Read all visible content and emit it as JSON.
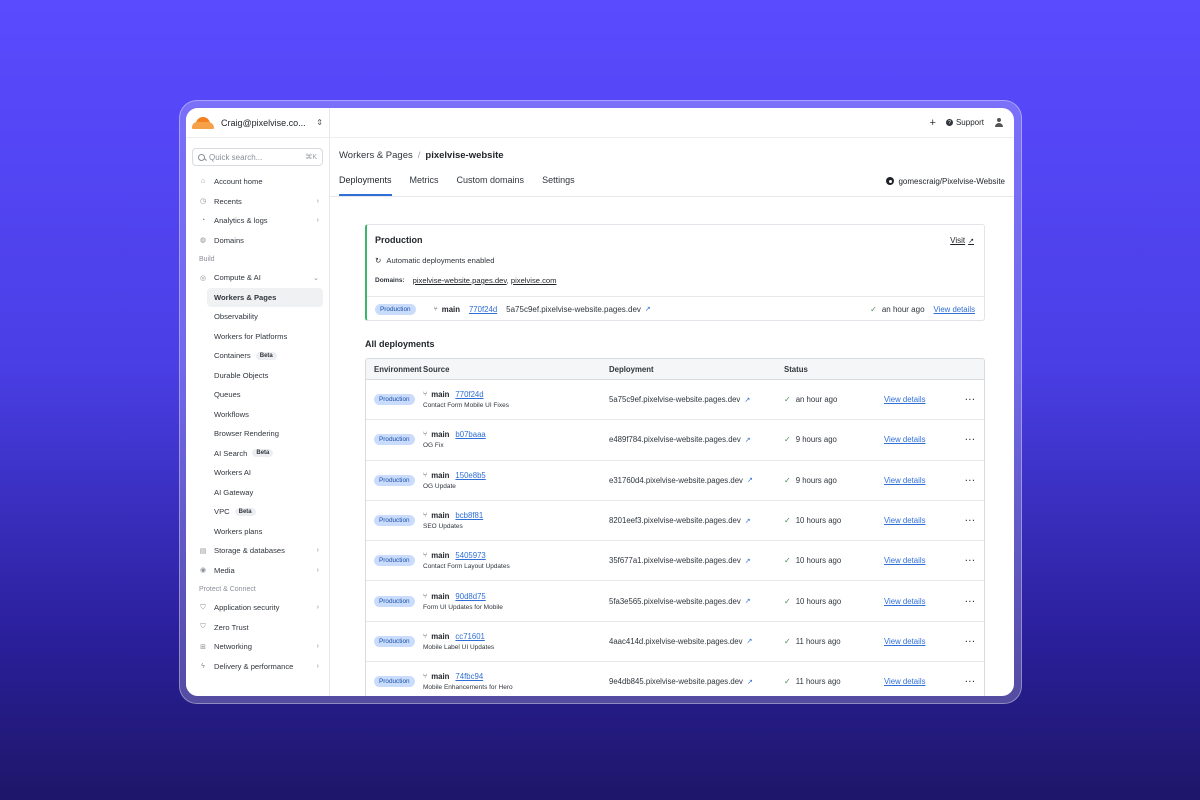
{
  "account": {
    "name": "Craig@pixelvise.co..."
  },
  "search": {
    "placeholder": "Quick search...",
    "shortcut": "⌘K"
  },
  "sidebar": {
    "top": [
      {
        "label": "Account home",
        "icon": "home-icon",
        "chev": false
      },
      {
        "label": "Recents",
        "icon": "clock-icon",
        "chev": true
      },
      {
        "label": "Analytics & logs",
        "icon": "chart-icon",
        "chev": true
      },
      {
        "label": "Domains",
        "icon": "globe-icon",
        "chev": false
      }
    ],
    "build_label": "Build",
    "compute": {
      "label": "Compute & AI",
      "icon": "cpu-icon"
    },
    "compute_items": [
      {
        "label": "Workers & Pages",
        "active": true,
        "beta": false
      },
      {
        "label": "Observability",
        "beta": false
      },
      {
        "label": "Workers for Platforms",
        "beta": false
      },
      {
        "label": "Containers",
        "beta": true
      },
      {
        "label": "Durable Objects",
        "beta": false
      },
      {
        "label": "Queues",
        "beta": false
      },
      {
        "label": "Workflows",
        "beta": false
      },
      {
        "label": "Browser Rendering",
        "beta": false
      },
      {
        "label": "AI Search",
        "beta": true
      },
      {
        "label": "Workers AI",
        "beta": false
      },
      {
        "label": "AI Gateway",
        "beta": false
      },
      {
        "label": "VPC",
        "beta": true
      },
      {
        "label": "Workers plans",
        "beta": false
      }
    ],
    "beta_label": "Beta",
    "after": [
      {
        "label": "Storage & databases",
        "icon": "database-icon",
        "chev": true
      },
      {
        "label": "Media",
        "icon": "media-icon",
        "chev": true
      }
    ],
    "protect_label": "Protect & Connect",
    "protect": [
      {
        "label": "Application security",
        "icon": "shield-icon",
        "chev": true
      },
      {
        "label": "Zero Trust",
        "icon": "shield-check-icon",
        "chev": false
      },
      {
        "label": "Networking",
        "icon": "network-icon",
        "chev": true
      },
      {
        "label": "Delivery & performance",
        "icon": "bolt-icon",
        "chev": true
      }
    ]
  },
  "topbar": {
    "plus": "+",
    "support": "Support"
  },
  "breadcrumb": {
    "parent": "Workers & Pages",
    "sep": "/",
    "current": "pixelvise-website"
  },
  "tabs": [
    "Deployments",
    "Metrics",
    "Custom domains",
    "Settings"
  ],
  "repo": "gomescraig/Pixelvise-Website",
  "production": {
    "title": "Production",
    "visit": "Visit",
    "auto": "Automatic deployments enabled",
    "domains_label": "Domains:",
    "domain1": "pixelvise-website.pages.dev",
    "comma": ",",
    "domain2": "pixelvise.com",
    "env": "Production",
    "branch": "main",
    "hash": "770f24d",
    "url": "5a75c9ef.pixelvise-website.pages.dev",
    "time": "an hour ago",
    "view": "View details"
  },
  "all_title": "All deployments",
  "table": {
    "headers": {
      "env": "Environment",
      "source": "Source",
      "deployment": "Deployment",
      "status": "Status"
    },
    "more": "···",
    "rows": [
      {
        "env": "Production",
        "branch": "main",
        "hash": "770f24d",
        "msg": "Contact Form Mobile UI Fixes",
        "url": "5a75c9ef.pixelvise-website.pages.dev",
        "time": "an hour ago",
        "view": "View details"
      },
      {
        "env": "Production",
        "branch": "main",
        "hash": "b07baaa",
        "msg": "OG Fix",
        "url": "e489f784.pixelvise-website.pages.dev",
        "time": "9 hours ago",
        "view": "View details"
      },
      {
        "env": "Production",
        "branch": "main",
        "hash": "150e8b5",
        "msg": "OG Update",
        "url": "e31760d4.pixelvise-website.pages.dev",
        "time": "9 hours ago",
        "view": "View details"
      },
      {
        "env": "Production",
        "branch": "main",
        "hash": "bcb8f81",
        "msg": "SEO Updates",
        "url": "8201eef3.pixelvise-website.pages.dev",
        "time": "10 hours ago",
        "view": "View details"
      },
      {
        "env": "Production",
        "branch": "main",
        "hash": "5405973",
        "msg": "Contact Form Layout Updates",
        "url": "35f677a1.pixelvise-website.pages.dev",
        "time": "10 hours ago",
        "view": "View details"
      },
      {
        "env": "Production",
        "branch": "main",
        "hash": "90d8d75",
        "msg": "Form UI Updates for Mobile",
        "url": "5fa3e565.pixelvise-website.pages.dev",
        "time": "10 hours ago",
        "view": "View details"
      },
      {
        "env": "Production",
        "branch": "main",
        "hash": "cc71601",
        "msg": "Mobile Label UI Updates",
        "url": "4aac414d.pixelvise-website.pages.dev",
        "time": "11 hours ago",
        "view": "View details"
      },
      {
        "env": "Production",
        "branch": "main",
        "hash": "74fbc94",
        "msg": "Mobile Enhancements for Hero",
        "url": "9e4db845.pixelvise-website.pages.dev",
        "time": "11 hours ago",
        "view": "View details"
      }
    ]
  },
  "colors": {
    "accent": "#2f6fd6",
    "production_border": "#3ab56a",
    "pill_bg": "#c9dcfb",
    "brand_orange": "#f48120"
  }
}
